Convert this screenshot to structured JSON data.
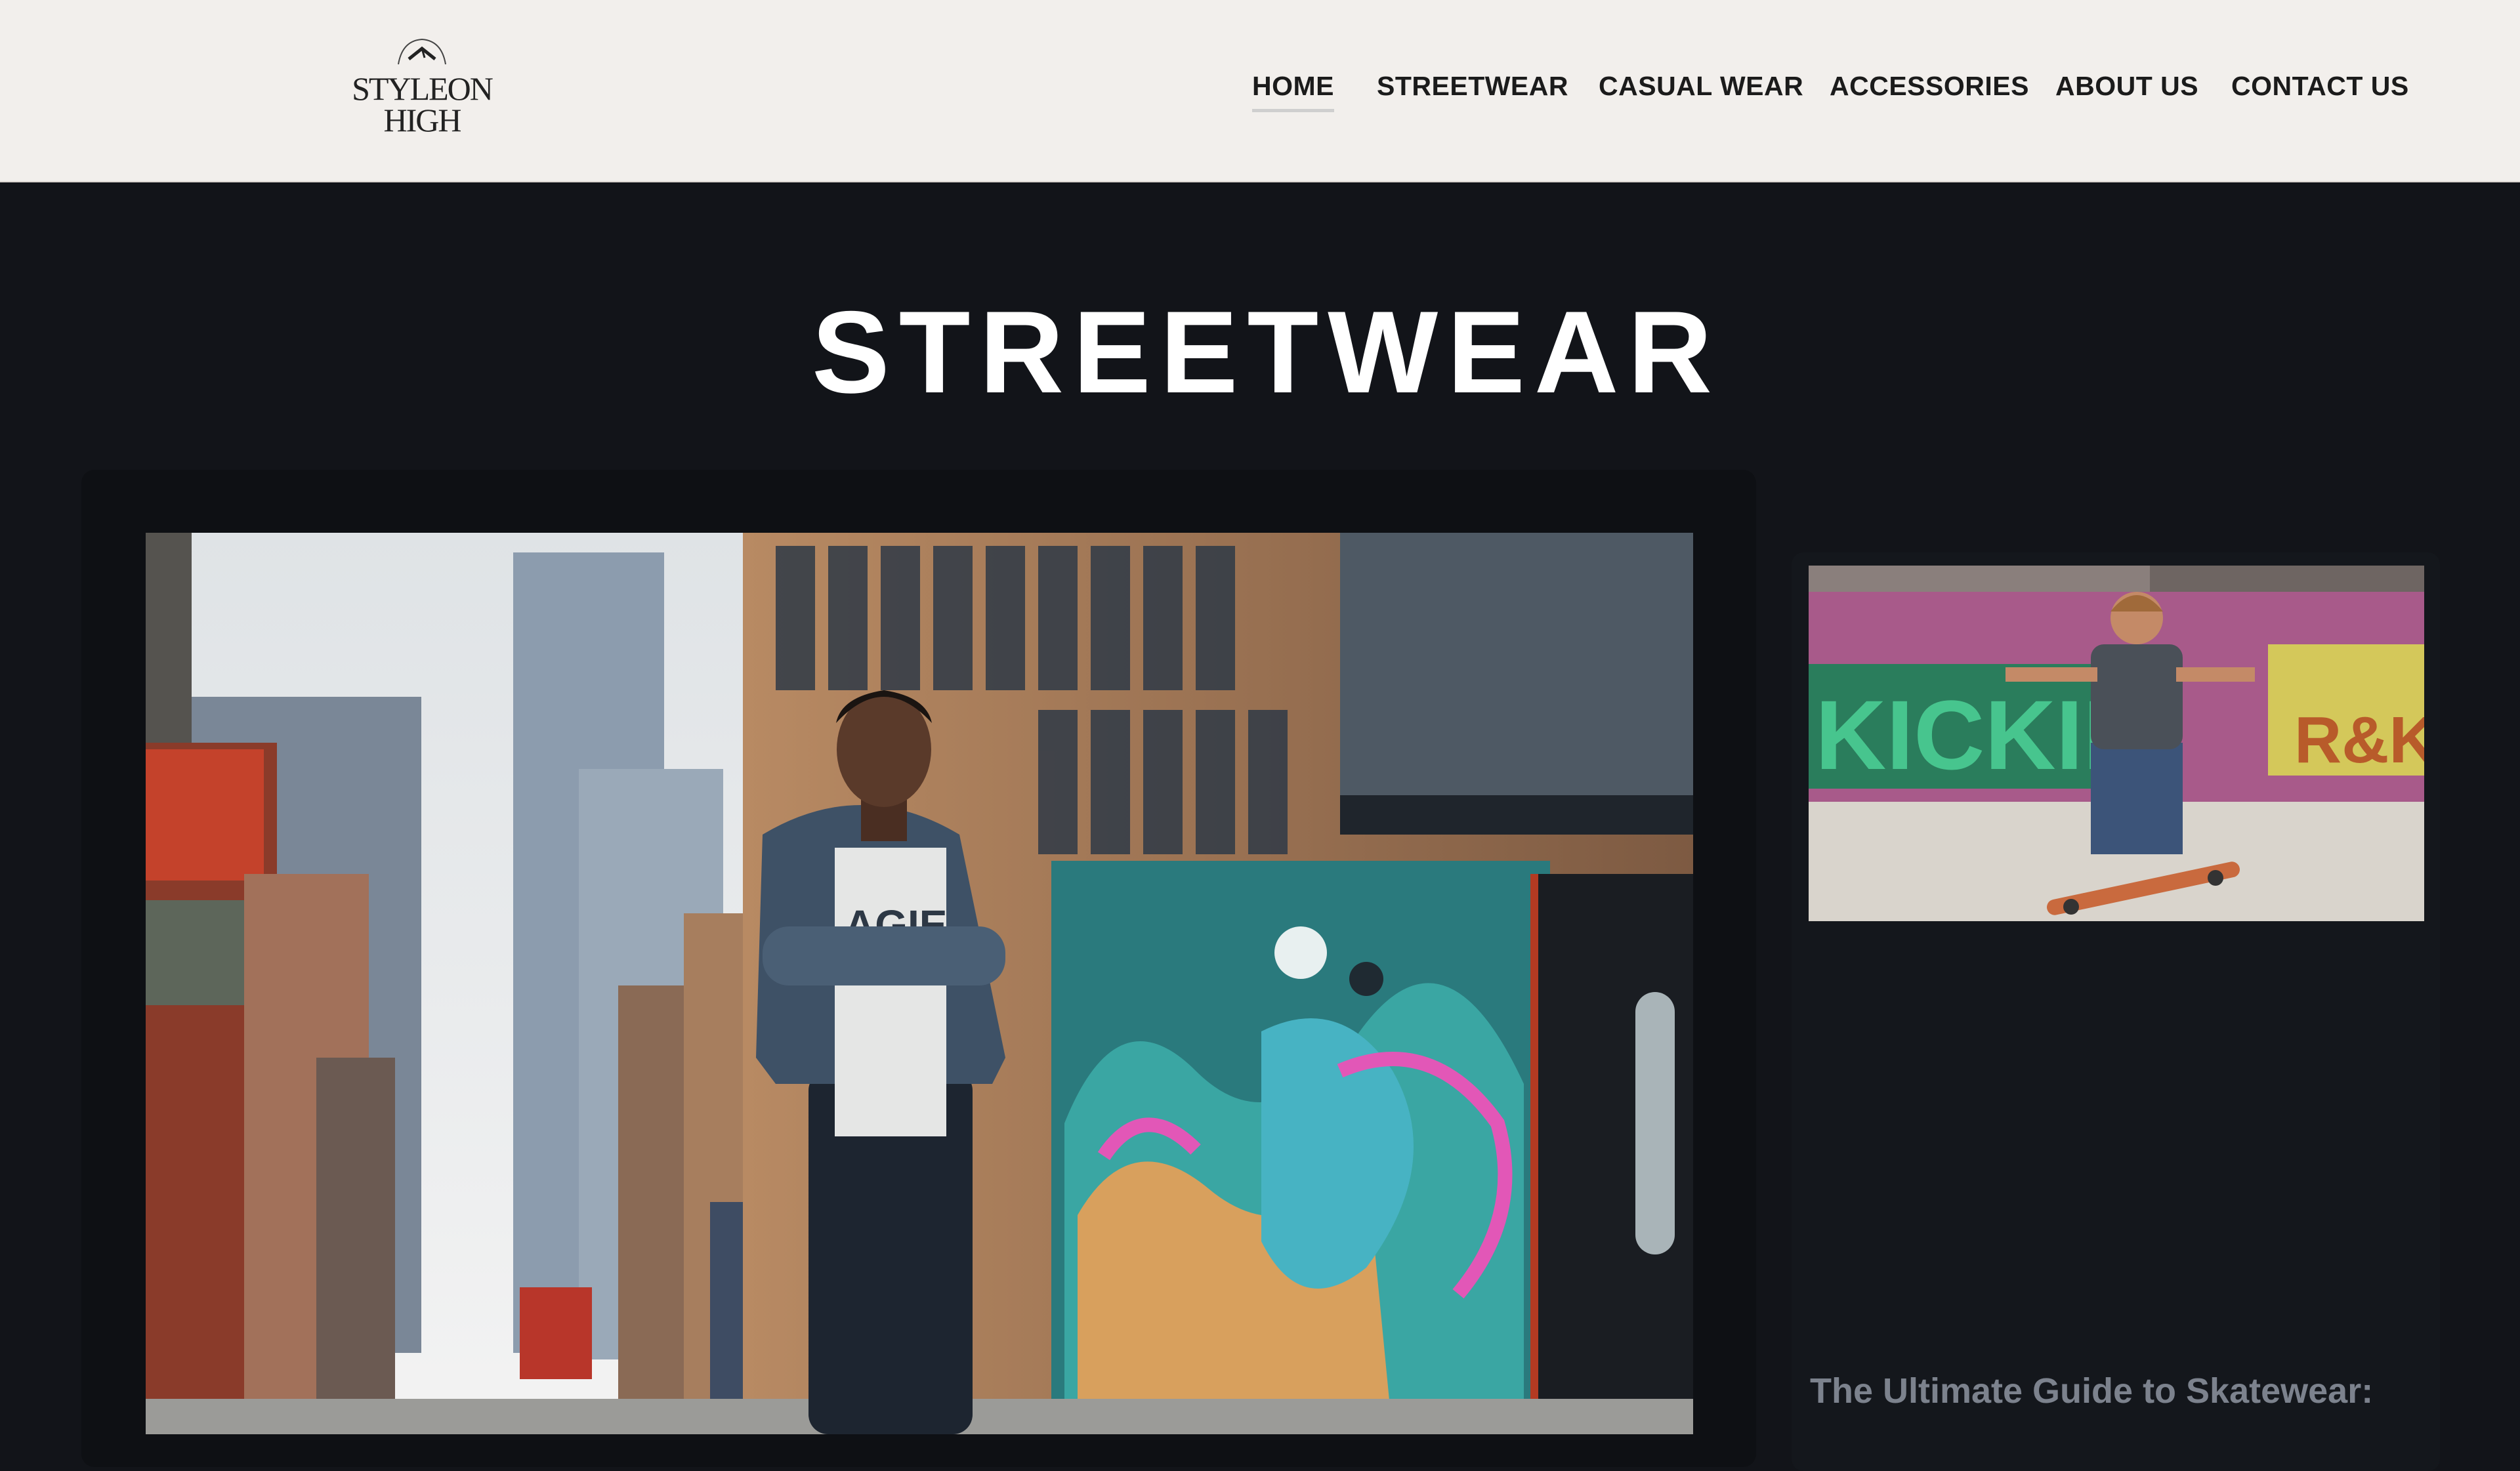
{
  "header": {
    "logo": {
      "line1": "STYLEON",
      "line2": "HIGH"
    },
    "nav": [
      {
        "label": "HOME",
        "active": true
      },
      {
        "label": "STREETWEAR",
        "active": false
      },
      {
        "label": "CASUAL WEAR",
        "active": false
      },
      {
        "label": "ACCESSORIES",
        "active": false
      },
      {
        "label": "ABOUT US",
        "active": false
      },
      {
        "label": "CONTACT US",
        "active": false
      }
    ]
  },
  "page": {
    "title": "STREETWEAR"
  },
  "featured": {
    "image_alt": "Man in a hoodie with crossed arms standing in front of a graffiti wall on a city street"
  },
  "side_post": {
    "image_alt": "Boy performing a trick on a skateboard at a graffiti-covered skate park",
    "title": "The Ultimate Guide to Skatewear:"
  },
  "colors": {
    "header_bg": "#f2efec",
    "page_bg": "#121419",
    "title": "#ffffff",
    "nav_text": "#1b1b1b",
    "side_title": "#7c828d"
  }
}
